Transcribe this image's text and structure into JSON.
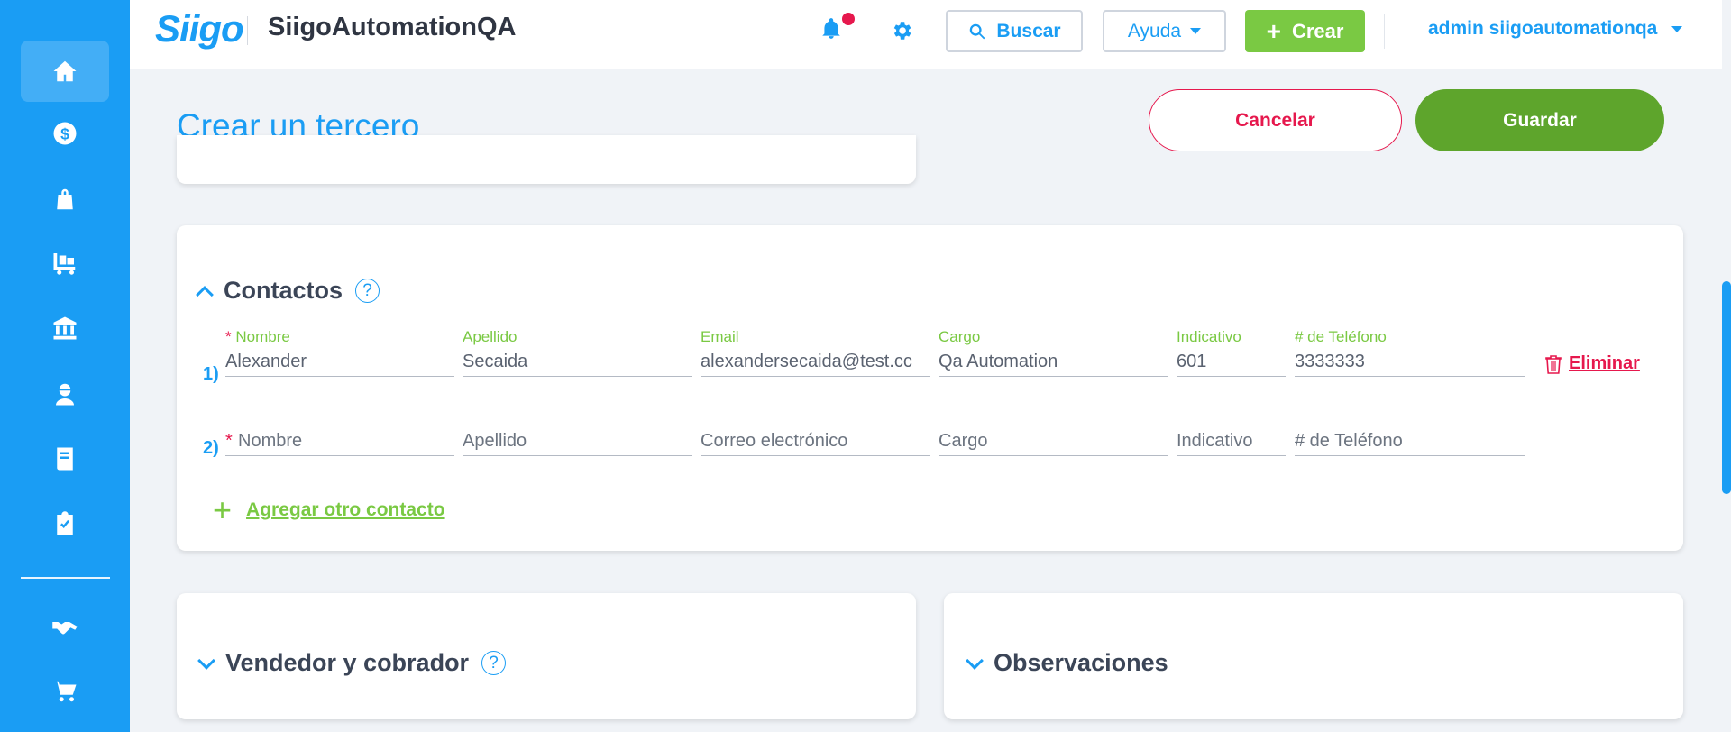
{
  "header": {
    "logo": "Siigo",
    "app_title": "SiigoAutomationQA",
    "search_label": "Buscar",
    "help_label": "Ayuda",
    "create_label": "Crear",
    "user_label": "admin siigoautomationqa"
  },
  "sidebar": {
    "items": [
      {
        "icon": "home-icon",
        "active": true
      },
      {
        "icon": "dollar-icon"
      },
      {
        "icon": "shopping-bag-icon"
      },
      {
        "icon": "cart-truck-icon"
      },
      {
        "icon": "bank-icon"
      },
      {
        "icon": "employee-icon"
      },
      {
        "icon": "book-icon"
      },
      {
        "icon": "clipboard-check-icon"
      },
      {
        "icon": "handshake-icon"
      },
      {
        "icon": "shopping-cart-icon"
      }
    ]
  },
  "page": {
    "title": "Crear un tercero",
    "cancel_label": "Cancelar",
    "save_label": "Guardar"
  },
  "contacts": {
    "title": "Contactos",
    "help": "?",
    "rows": [
      {
        "index": "1)",
        "labels": {
          "nombre": "Nombre",
          "apellido": "Apellido",
          "email": "Email",
          "cargo": "Cargo",
          "indicativo": "Indicativo",
          "telefono": "# de Teléfono"
        },
        "values": {
          "nombre": "Alexander",
          "apellido": "Secaida",
          "email": "alexandersecaida@test.cc",
          "cargo": "Qa Automation",
          "indicativo": "601",
          "telefono": "3333333"
        },
        "delete_label": "Eliminar"
      },
      {
        "index": "2)",
        "placeholders": {
          "nombre": "Nombre",
          "apellido": "Apellido",
          "email": "Correo electrónico",
          "cargo": "Cargo",
          "indicativo": "Indicativo",
          "telefono": "# de Teléfono"
        }
      }
    ],
    "add_label": "Agregar otro contacto",
    "required_mark": "*"
  },
  "sections": {
    "vendedor": {
      "title": "Vendedor y cobrador",
      "help": "?"
    },
    "observaciones": {
      "title": "Observaciones"
    }
  },
  "colors": {
    "primary": "#1a9df4",
    "green": "#7ac943",
    "save_green": "#5ea52c",
    "danger": "#e6184d"
  }
}
